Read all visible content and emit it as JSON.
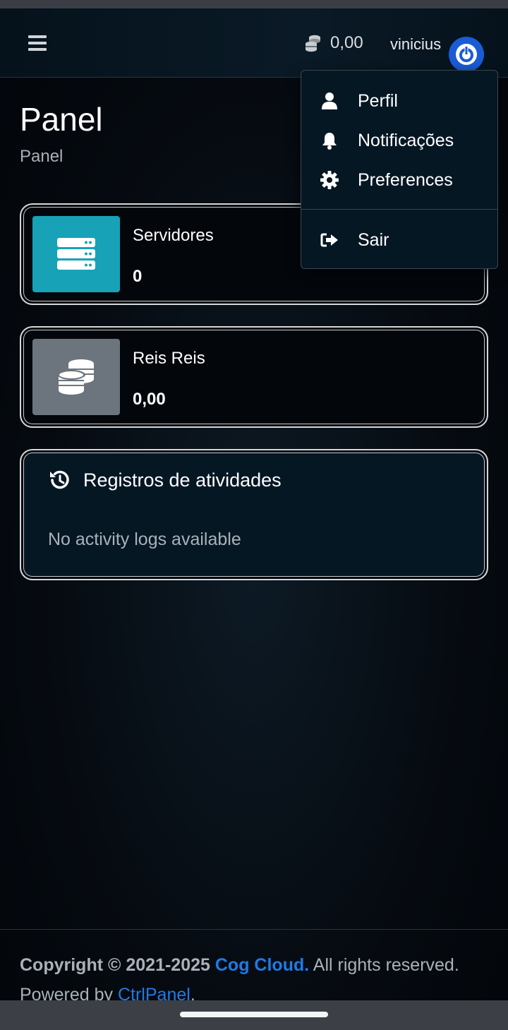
{
  "navbar": {
    "credits_value": "0,00",
    "username": "vinicius"
  },
  "page": {
    "title": "Panel",
    "breadcrumb": "Panel"
  },
  "cards": {
    "servers": {
      "label": "Servidores",
      "value": "0"
    },
    "money": {
      "label": "Reis Reis",
      "value": "0,00"
    }
  },
  "activity": {
    "title": "Registros de atividades",
    "empty_text": "No activity logs available"
  },
  "user_menu": {
    "items": [
      {
        "label": "Perfil",
        "icon": "user-icon"
      },
      {
        "label": "Notificações",
        "icon": "bell-icon"
      },
      {
        "label": "Preferences",
        "icon": "gear-icon"
      },
      {
        "label": "Sair",
        "icon": "sign-out-icon"
      }
    ]
  },
  "footer": {
    "copyright_prefix": "Copyright © 2021-2025",
    "brand": "Cog Cloud.",
    "rights": "All rights reserved.",
    "powered_prefix": "Powered by",
    "powered_link": "CtrlPanel",
    "powered_suffix": "."
  },
  "colors": {
    "accent_blue": "#1a5cd6",
    "link_blue": "#1f7ae6",
    "servers_box": "#17a2b8",
    "money_box": "#6c757d"
  }
}
